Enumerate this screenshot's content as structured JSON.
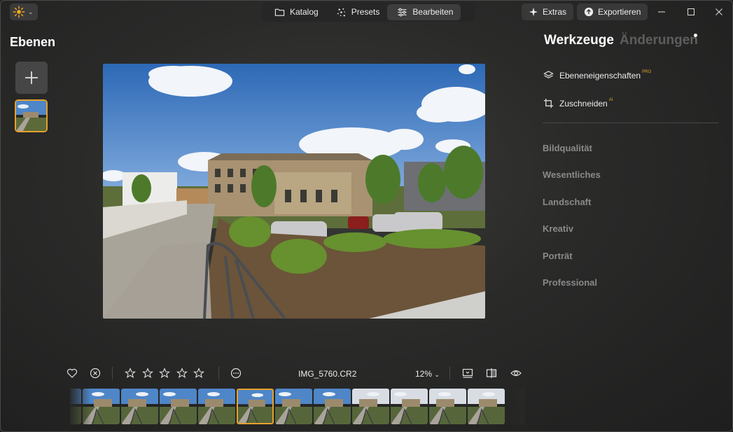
{
  "topbar": {
    "app_menu_icon": "sun-logo-icon",
    "tabs": [
      {
        "label": "Katalog",
        "icon": "folder-icon"
      },
      {
        "label": "Presets",
        "icon": "sparkle-dots-icon"
      },
      {
        "label": "Bearbeiten",
        "icon": "sliders-icon"
      }
    ],
    "active_tab": "Bearbeiten",
    "extras_label": "Extras",
    "export_label": "Exportieren"
  },
  "layers": {
    "title": "Ebenen"
  },
  "right_panel": {
    "tab_tools": "Werkzeuge",
    "tab_changes": "Änderungen",
    "tools": [
      {
        "label": "Ebeneneigenschaften",
        "badge": "PRO",
        "icon": "layers-icon"
      },
      {
        "label": "Zuschneiden",
        "badge": "AI",
        "icon": "crop-icon"
      }
    ],
    "categories": [
      "Bildqualität",
      "Wesentliches",
      "Landschaft",
      "Kreativ",
      "Porträt",
      "Professional"
    ]
  },
  "bottom_bar": {
    "filename": "IMG_5760.CR2",
    "zoom": "12%",
    "rating_stars": 0,
    "rating_max": 5
  },
  "filmstrip": {
    "count": 12,
    "selected_index": 5
  },
  "colors": {
    "accent": "#e5a12c",
    "background": "#2a2a29",
    "category_text": "#8a8a8a"
  }
}
